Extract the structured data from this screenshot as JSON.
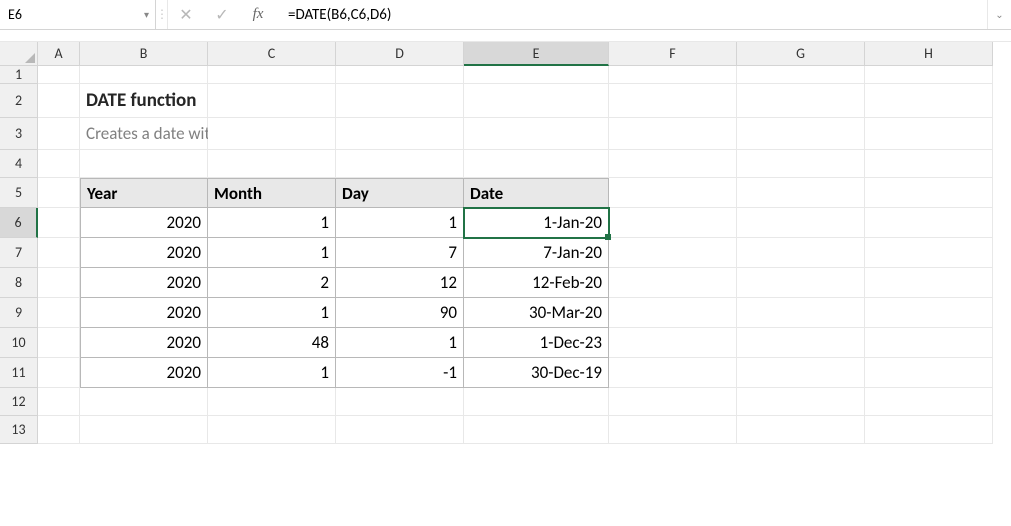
{
  "nameBox": {
    "value": "E6"
  },
  "formulaBar": {
    "content": "=DATE(B6,C6,D6)"
  },
  "icons": {
    "cancel": "✕",
    "enter": "✓",
    "fx": "fx",
    "expand": "⌄",
    "dropdown": "▾",
    "dots": "⋮"
  },
  "columns": [
    "A",
    "B",
    "C",
    "D",
    "E",
    "F",
    "G",
    "H"
  ],
  "rows": [
    "1",
    "2",
    "3",
    "4",
    "5",
    "6",
    "7",
    "8",
    "9",
    "10",
    "11",
    "12",
    "13"
  ],
  "activeCell": {
    "col": "E",
    "row": "6"
  },
  "content": {
    "title": "DATE function",
    "subtitle": "Creates a date with year, month, and day",
    "headers": {
      "B": "Year",
      "C": "Month",
      "D": "Day",
      "E": "Date"
    },
    "dataRows": [
      {
        "B": "2020",
        "C": "1",
        "D": "1",
        "E": "1-Jan-20"
      },
      {
        "B": "2020",
        "C": "1",
        "D": "7",
        "E": "7-Jan-20"
      },
      {
        "B": "2020",
        "C": "2",
        "D": "12",
        "E": "12-Feb-20"
      },
      {
        "B": "2020",
        "C": "1",
        "D": "90",
        "E": "30-Mar-20"
      },
      {
        "B": "2020",
        "C": "48",
        "D": "1",
        "E": "1-Dec-23"
      },
      {
        "B": "2020",
        "C": "1",
        "D": "-1",
        "E": "30-Dec-19"
      }
    ]
  },
  "chart_data": {
    "type": "table",
    "title": "DATE function",
    "columns": [
      "Year",
      "Month",
      "Day",
      "Date"
    ],
    "rows": [
      [
        2020,
        1,
        1,
        "1-Jan-20"
      ],
      [
        2020,
        1,
        7,
        "7-Jan-20"
      ],
      [
        2020,
        2,
        12,
        "12-Feb-20"
      ],
      [
        2020,
        1,
        90,
        "30-Mar-20"
      ],
      [
        2020,
        48,
        1,
        "1-Dec-23"
      ],
      [
        2020,
        1,
        -1,
        "30-Dec-19"
      ]
    ]
  }
}
